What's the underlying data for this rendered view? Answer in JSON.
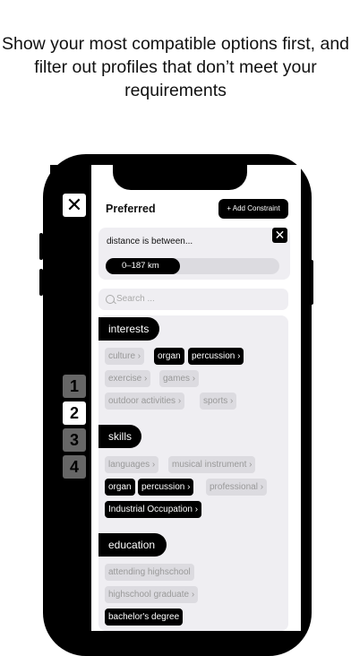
{
  "headline": "Show your most compatible options first, and filter out profiles that don’t meet your requirements",
  "left_panel": {
    "close_glyph": "✕",
    "steps": [
      "1",
      "2",
      "3",
      "4"
    ],
    "active_step": "2"
  },
  "header": {
    "title": "Preferred",
    "add_label": "+ Add Constraint"
  },
  "constraint": {
    "label": "distance is between...",
    "range": "0–187 km",
    "close_glyph": "✕",
    "fill_fraction": 0.43
  },
  "search": {
    "placeholder": "Search ..."
  },
  "sections": [
    {
      "title": "interests",
      "rows": [
        [
          {
            "label": "culture ›",
            "selected": false
          },
          {
            "label": "organ",
            "selected": true
          },
          {
            "label": "percussion ›",
            "selected": true
          }
        ],
        [
          {
            "label": "exercise ›",
            "selected": false
          },
          {
            "label": "games ›",
            "selected": false
          }
        ],
        [
          {
            "label": "outdoor activities ›",
            "selected": false
          },
          {
            "label": "sports ›",
            "selected": false
          }
        ]
      ]
    },
    {
      "title": "skills",
      "rows": [
        [
          {
            "label": "languages ›",
            "selected": false
          },
          {
            "label": "musical instrument ›",
            "selected": false
          }
        ],
        [
          {
            "label": "organ",
            "selected": true
          },
          {
            "label": "percussion ›",
            "selected": true
          },
          {
            "label": "professional ›",
            "selected": false
          }
        ],
        [
          {
            "label": "Industrial Occupation ›",
            "selected": true
          }
        ]
      ]
    },
    {
      "title": "education",
      "rows": [
        [
          {
            "label": "attending highschool",
            "selected": false
          }
        ],
        [
          {
            "label": "highschool graduate ›",
            "selected": false
          }
        ],
        [
          {
            "label": "bachelor's degree",
            "selected": true
          }
        ]
      ]
    }
  ],
  "colors": {
    "accent": "#000000",
    "card_bg": "#efeef2",
    "chip_off": "#dcdbe0"
  }
}
